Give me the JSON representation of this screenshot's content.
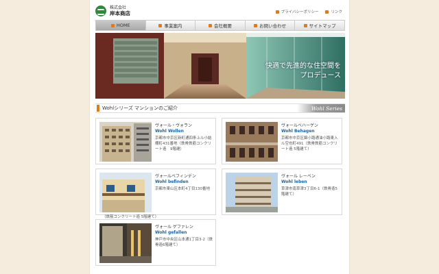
{
  "header": {
    "logo_sub": "株式会社",
    "logo_name": "岸本商店",
    "top_links": [
      {
        "label": "プライバシーポリシー"
      },
      {
        "label": "リンク"
      }
    ]
  },
  "nav": {
    "items": [
      {
        "label": "HOME"
      },
      {
        "label": "事業案内"
      },
      {
        "label": "会社概要"
      },
      {
        "label": "お問い合わせ"
      },
      {
        "label": "サイトマップ"
      }
    ]
  },
  "hero": {
    "line1": "快適で先進的な住空間を",
    "line2": "プロデュース"
  },
  "section": {
    "title": "Wohlシリーズ マンションのご紹介",
    "tag": "Wohl Series"
  },
  "properties": [
    {
      "name_jp": "ヴォール・ヴォラン",
      "name_en": "Wohl Wollen",
      "address": "京都市中京区新町通四条上ル小結棚町431番地（鉄骨鉄筋コンクリート造　9階建）"
    },
    {
      "name_jp": "ヴォールベハーゲン",
      "name_en": "Wohl Behagen",
      "address": "京都市中京区錦小路通油小路東入ル空也町491（鉄骨鉄筋コンクリート造 5階建て）"
    },
    {
      "name_jp": "ヴォールベフィンデン",
      "name_en": "Wohl befinden",
      "address": "京都市東山区本町4丁目130番地",
      "address_overflow": "（鉄筋コンクリート造 5階建て）"
    },
    {
      "name_jp": "ヴォール レーベン",
      "name_en": "Wohl leben",
      "address": "草津市南草津3丁目6-1（鉄骨造5階建て）"
    },
    {
      "name_jp": "ヴォール ゲファレン",
      "name_en": "Wohl gefallen",
      "address": "神戸市中央区山本通1丁目3-2（鉄骨造6階建て）"
    }
  ]
}
